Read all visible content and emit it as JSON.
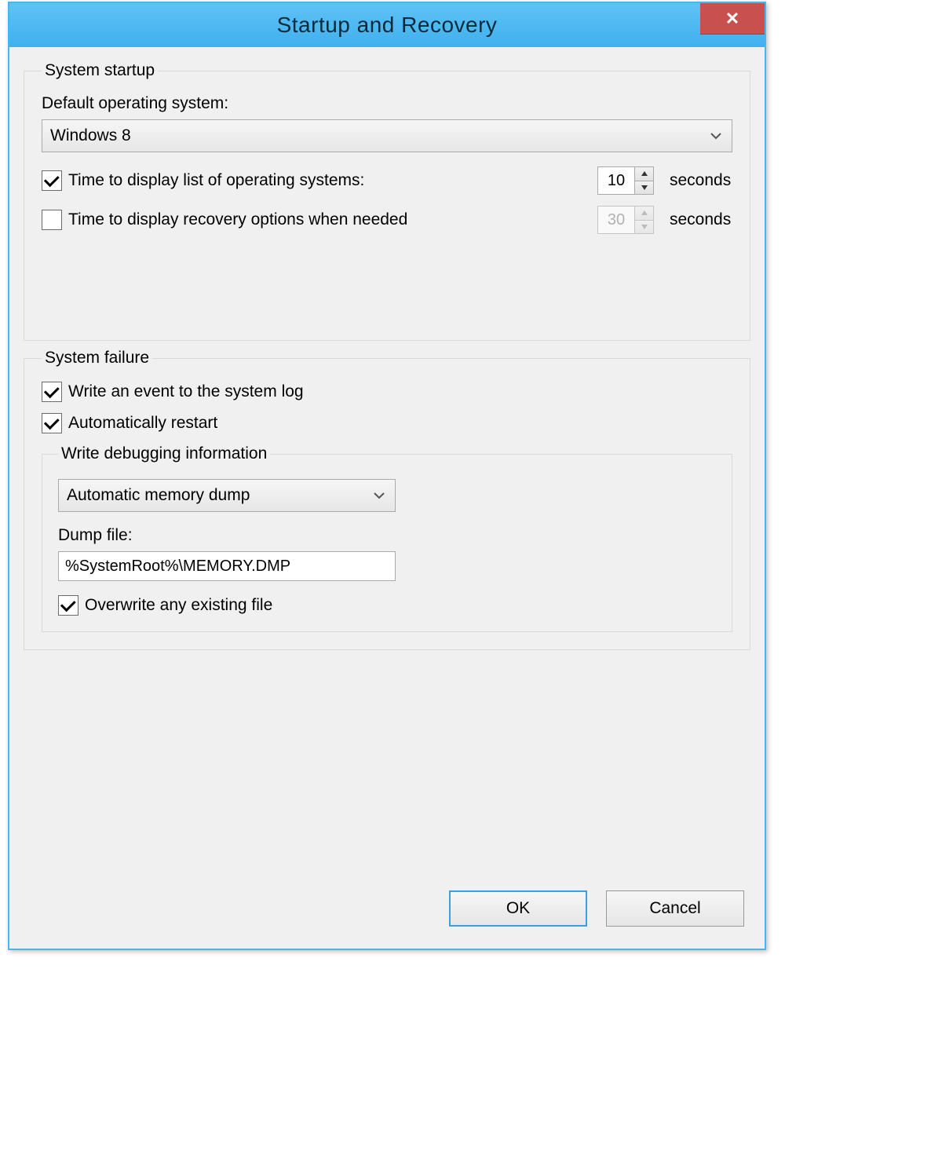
{
  "window": {
    "title": "Startup and Recovery",
    "close_glyph": "✕"
  },
  "startup": {
    "legend": "System startup",
    "default_os_label": "Default operating system:",
    "default_os_value": "Windows 8",
    "display_os_list": {
      "checked": true,
      "label": "Time to display list of operating systems:",
      "value": "10",
      "unit": "seconds"
    },
    "display_recovery": {
      "checked": false,
      "label": "Time to display recovery options when needed",
      "value": "30",
      "unit": "seconds"
    }
  },
  "failure": {
    "legend": "System failure",
    "write_event": {
      "checked": true,
      "label": "Write an event to the system log"
    },
    "auto_restart": {
      "checked": true,
      "label": "Automatically restart"
    },
    "debug": {
      "legend": "Write debugging information",
      "dump_type": "Automatic memory dump",
      "dump_file_label": "Dump file:",
      "dump_file_value": "%SystemRoot%\\MEMORY.DMP",
      "overwrite": {
        "checked": true,
        "label": "Overwrite any existing file"
      }
    }
  },
  "buttons": {
    "ok": "OK",
    "cancel": "Cancel"
  }
}
